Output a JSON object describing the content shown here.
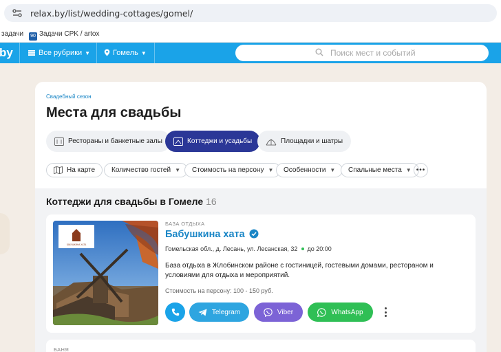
{
  "browser": {
    "url": "relax.by/list/wedding-cottages/gomel/",
    "bookmarks": [
      {
        "label": "задачи"
      },
      {
        "label": "Задачи CPK / artox",
        "icon_text": "90"
      }
    ]
  },
  "site_nav": {
    "logo": "by",
    "rubrics": "Все рубрики",
    "city": "Гомель",
    "search_placeholder": "Поиск мест и событий"
  },
  "page": {
    "eyebrow": "Свадебный сезон",
    "title": "Места для свадьбы",
    "categories": [
      {
        "label": "Рестораны и банкетные залы"
      },
      {
        "label": "Коттеджи и усадьбы",
        "active": true
      },
      {
        "label": "Площадки и шатры"
      }
    ],
    "filters": [
      {
        "label": "На карте"
      },
      {
        "label": "Количество гостей"
      },
      {
        "label": "Стоимость на персону"
      },
      {
        "label": "Особенности"
      },
      {
        "label": "Спальные места"
      }
    ]
  },
  "listing": {
    "title": "Коттеджи для свадьбы в Гомеле",
    "count": "16",
    "places": [
      {
        "type": "БАЗА ОТДЫХА",
        "name": "Бабушкина хата",
        "address": "Гомельская обл., д. Лесань, ул. Лесанская, 32",
        "hours": "до 20:00",
        "description": "База отдыха в Жлобинском районе с гостиницей, гостевыми домами, рестораном и условиями для отдыха и мероприятий.",
        "price": "Стоимость на персону: 100 - 150 руб.",
        "buttons": {
          "telegram": "Telegram",
          "viber": "Viber",
          "whatsapp": "WhatsApp"
        },
        "photo_logo_text": "БАБУШКИНА ХАТА"
      },
      {
        "type": "БАНЯ"
      }
    ]
  },
  "colors": {
    "brand_blue": "#1aa3e8",
    "active_chip": "#2b3797",
    "telegram": "#2ea5e0",
    "viber": "#7c63d6",
    "whatsapp": "#2fbf55"
  }
}
